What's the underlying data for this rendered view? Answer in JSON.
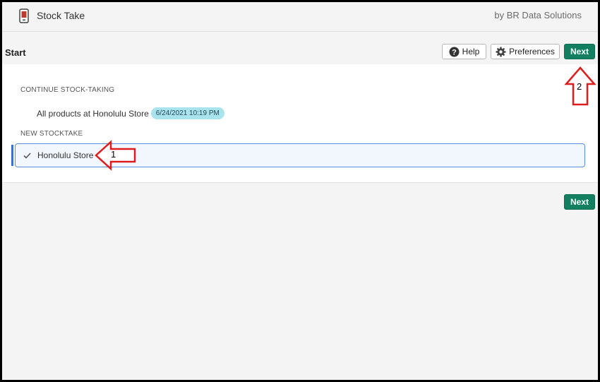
{
  "app": {
    "title": "Stock Take",
    "vendor": "by BR Data Solutions"
  },
  "toolbar": {
    "page_title": "Start",
    "help_label": "Help",
    "preferences_label": "Preferences",
    "next_label": "Next"
  },
  "continue_section": {
    "label": "CONTINUE STOCK-TAKING",
    "item_label": "All products at Honolulu Store",
    "item_date": "6/24/2021 10:19 PM"
  },
  "new_section": {
    "label": "NEW STOCKTAKE",
    "selected_store": "Honolulu Store"
  },
  "footer": {
    "next_label": "Next"
  },
  "annotations": {
    "step1": "1",
    "step2": "2"
  },
  "colors": {
    "primary": "#128060",
    "badge": "#a8e3ee",
    "selection_border": "#5b8ee0",
    "arrow": "#e01b1b"
  }
}
